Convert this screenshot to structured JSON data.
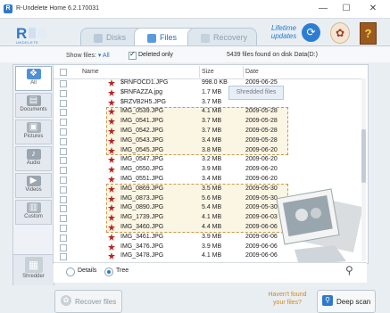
{
  "window": {
    "title": "R-Undelete Home 6.2.170031",
    "min": "—",
    "max": "☐",
    "close": "✕"
  },
  "logo": {
    "text": "R",
    "subtext": "UNDELETE"
  },
  "tabs": [
    {
      "label": "Disks",
      "active": false
    },
    {
      "label": "Files",
      "active": true
    },
    {
      "label": "Recovery",
      "active": false
    }
  ],
  "header": {
    "lifetime_updates": "Lifetime updates",
    "update_icon": "refresh-icon",
    "help_icon": "help-icon",
    "book_icon": "manual-icon",
    "book_glyph": "?"
  },
  "filter": {
    "show_files_label": "Show files:",
    "show_files_value": "All",
    "deleted_only_label": "Deleted only",
    "deleted_only_checked": true,
    "found_text": "5439 files found on disk Data(D:)"
  },
  "categories": [
    {
      "label": "All",
      "active": true
    },
    {
      "label": "Documents",
      "active": false
    },
    {
      "label": "Pictures",
      "active": false
    },
    {
      "label": "Audio",
      "active": false
    },
    {
      "label": "Videos",
      "active": false
    },
    {
      "label": "Custom",
      "active": false
    }
  ],
  "shredder": {
    "label": "Shredder"
  },
  "table": {
    "columns": [
      "Name",
      "Size",
      "Date"
    ],
    "tooltip": "Shredded files",
    "rows": [
      {
        "name": "$RNFOCD1.JPG",
        "size": "998.0 KB",
        "date": "2009-06-25",
        "group": ""
      },
      {
        "name": "$RNFAZZA.jpg",
        "size": "1.7 MB",
        "date": "",
        "group": ""
      },
      {
        "name": "$RZVB2H5.JPG",
        "size": "3.7 MB",
        "date": "",
        "group": ""
      },
      {
        "name": "IMG_0539.JPG",
        "size": "4.1 MB",
        "date": "2009-05-28",
        "group": "a"
      },
      {
        "name": "IMG_0541.JPG",
        "size": "3.7 MB",
        "date": "2009-05-28",
        "group": "a"
      },
      {
        "name": "IMG_0542.JPG",
        "size": "3.7 MB",
        "date": "2009-05-28",
        "group": "a"
      },
      {
        "name": "IMG_0543.JPG",
        "size": "3.4 MB",
        "date": "2009-05-28",
        "group": "a"
      },
      {
        "name": "IMG_0545.JPG",
        "size": "3.8 MB",
        "date": "2009-06-20",
        "group": "a"
      },
      {
        "name": "IMG_0547.JPG",
        "size": "3.2 MB",
        "date": "2009-06-20",
        "group": ""
      },
      {
        "name": "IMG_0550.JPG",
        "size": "3.9 MB",
        "date": "2009-06-20",
        "group": ""
      },
      {
        "name": "IMG_0551.JPG",
        "size": "3.4 MB",
        "date": "2009-06-20",
        "group": ""
      },
      {
        "name": "IMG_0869.JPG",
        "size": "3.5 MB",
        "date": "2009-05-30",
        "group": "b"
      },
      {
        "name": "IMG_0873.JPG",
        "size": "5.6 MB",
        "date": "2009-05-30",
        "group": "b"
      },
      {
        "name": "IMG_0890.JPG",
        "size": "5.4 MB",
        "date": "2009-05-30",
        "group": "b"
      },
      {
        "name": "IMG_1739.JPG",
        "size": "4.1 MB",
        "date": "2009-06-03",
        "group": "b"
      },
      {
        "name": "IMG_3460.JPG",
        "size": "4.4 MB",
        "date": "2009-06-06",
        "group": "b"
      },
      {
        "name": "IMG_3461.JPG",
        "size": "3.9 MB",
        "date": "2009-06-06",
        "group": ""
      },
      {
        "name": "IMG_3476.JPG",
        "size": "3.9 MB",
        "date": "2009-06-06",
        "group": ""
      },
      {
        "name": "IMG_3478.JPG",
        "size": "4.1 MB",
        "date": "2009-06-06",
        "group": ""
      }
    ]
  },
  "view": {
    "details_label": "Details",
    "tree_label": "Tree",
    "selected": "Tree"
  },
  "footer": {
    "recover_label": "Recover files",
    "havent_found": "Haven't found your files?",
    "deep_scan_label": "Deep scan"
  },
  "colors": {
    "accent": "#2478d0",
    "group_border": "#c69a4b",
    "file_icon": "#b3261e"
  }
}
